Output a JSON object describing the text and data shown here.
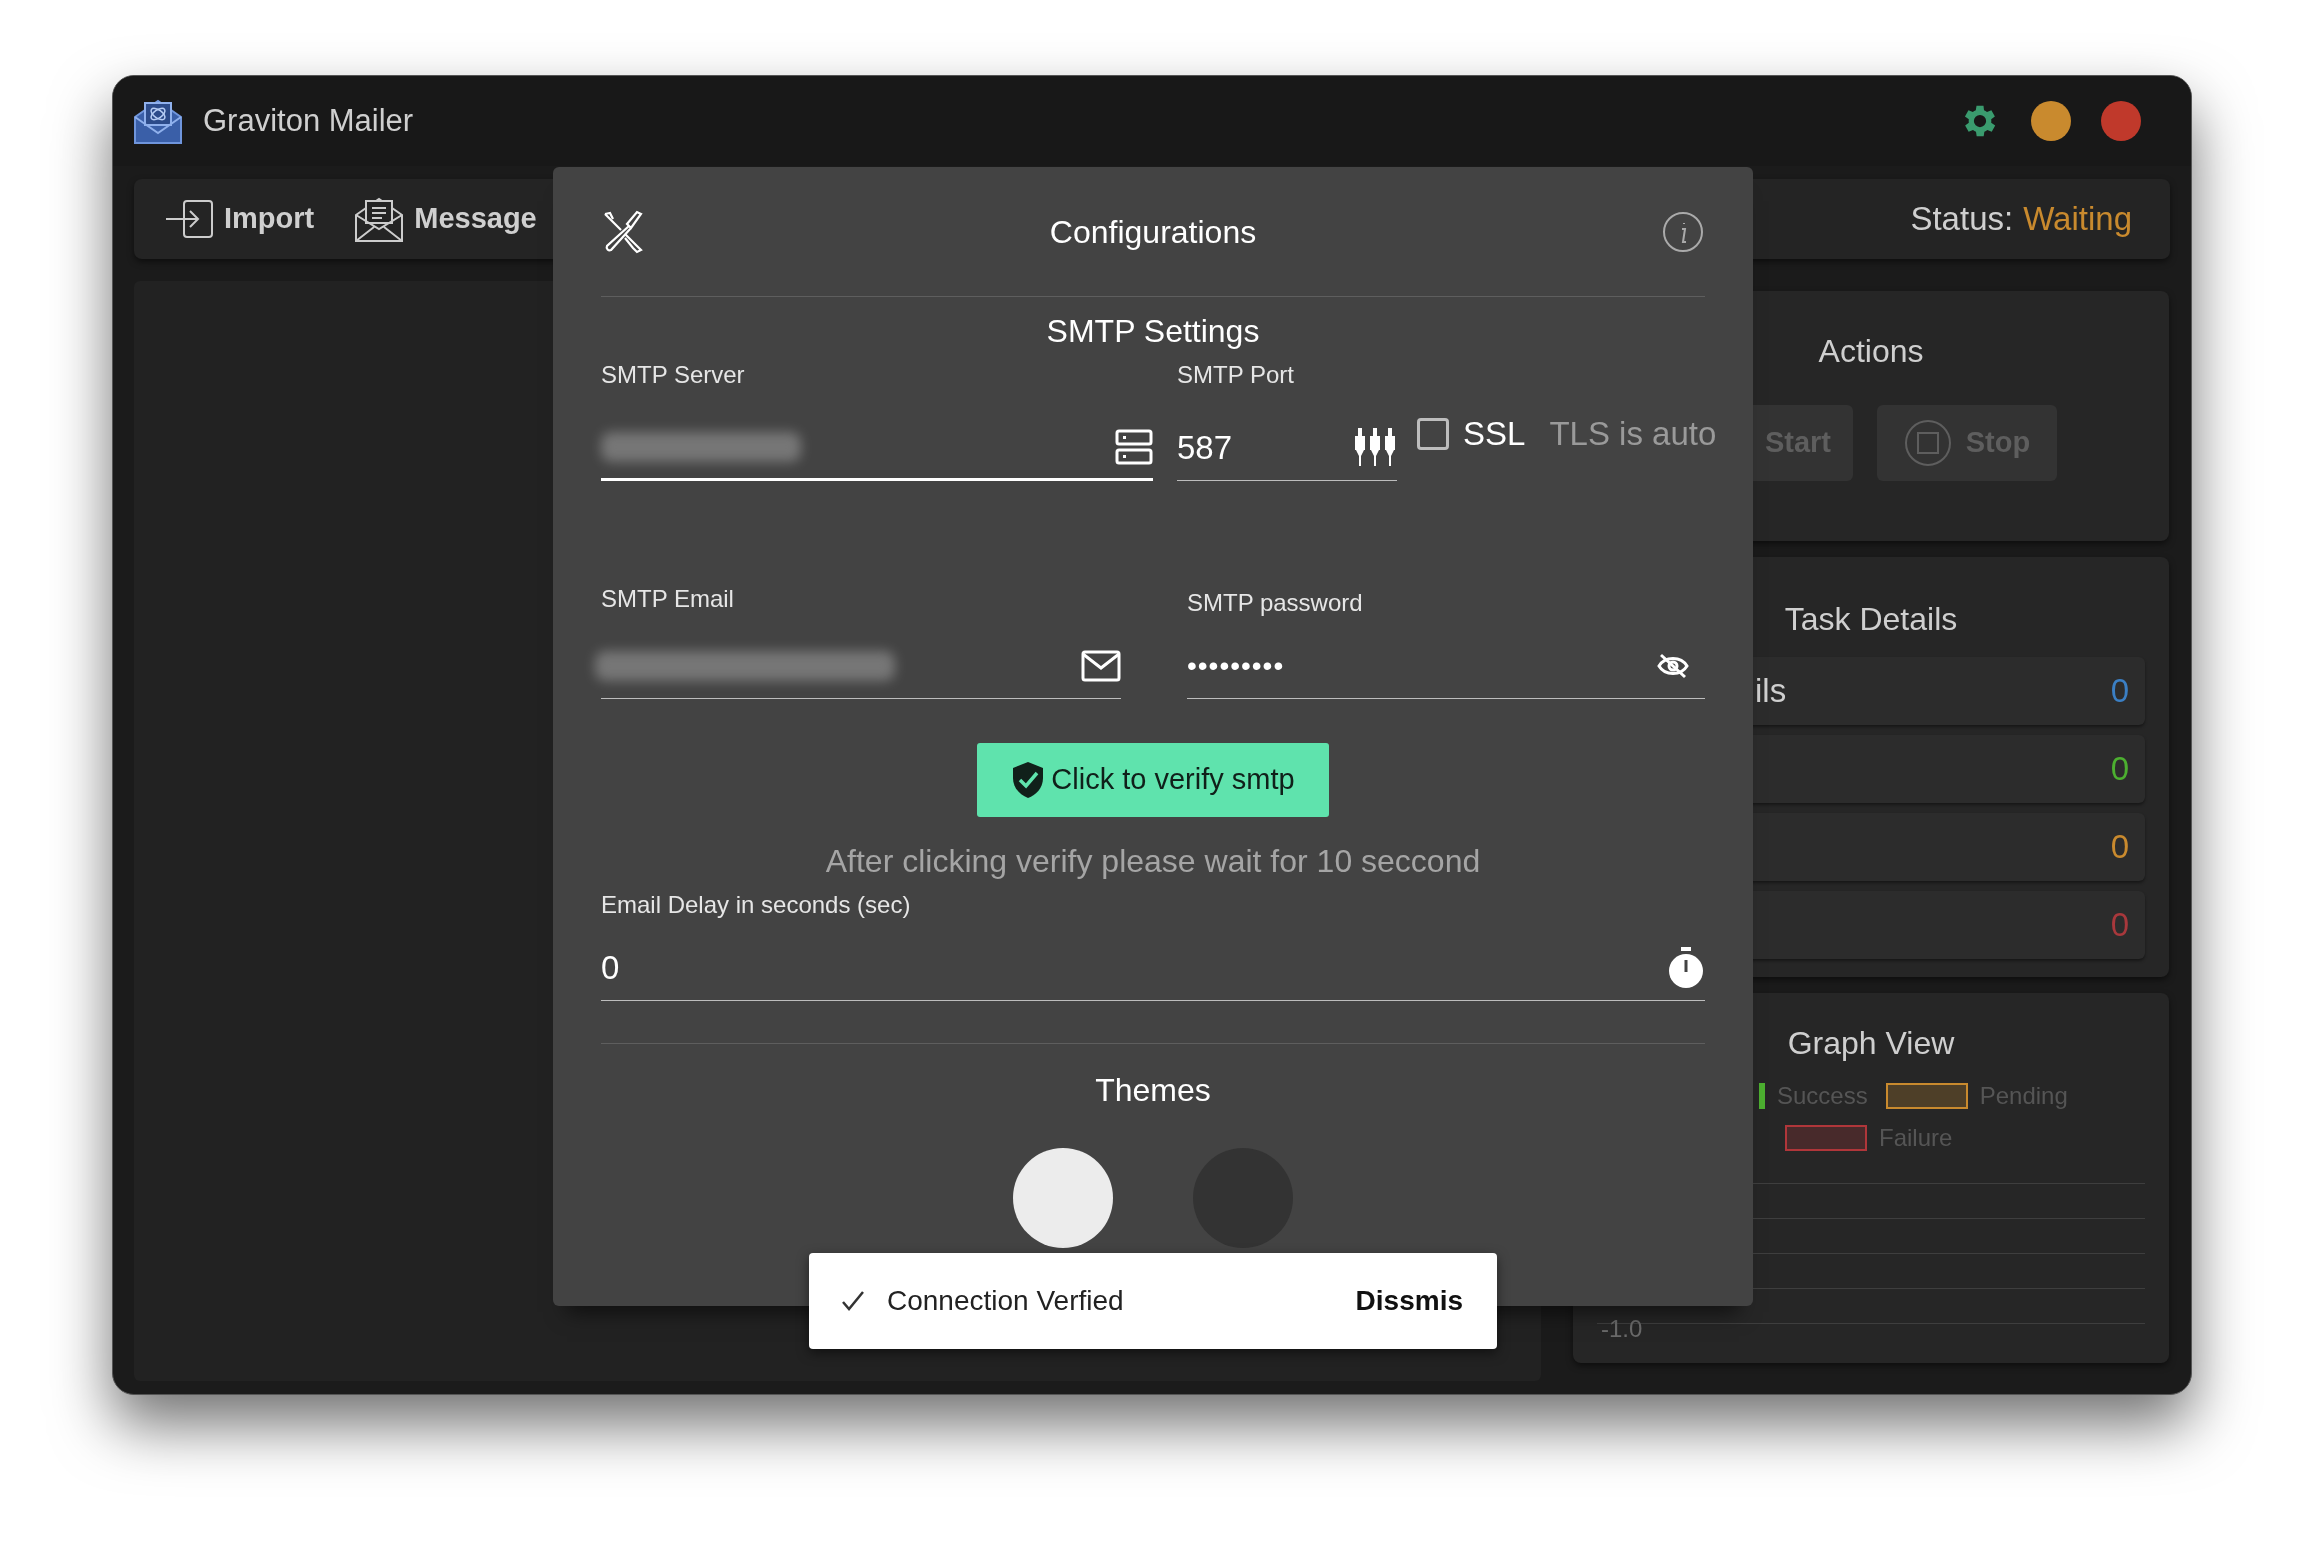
{
  "app": {
    "title": "Graviton Mailer"
  },
  "toolbar": {
    "items": [
      {
        "label": "Import",
        "kind": "import"
      },
      {
        "label": "Message",
        "kind": "message"
      }
    ],
    "status_label": "Status:",
    "status_value": "Waiting"
  },
  "actions": {
    "title": "Actions",
    "buttons": [
      {
        "label": "Start",
        "disabled": true,
        "kind": "start"
      },
      {
        "label": "Stop",
        "disabled": true,
        "kind": "stop"
      }
    ]
  },
  "task_details": {
    "title": "Task Details",
    "rows": [
      {
        "label": "ils",
        "value": "0",
        "color": "#3b7fc4"
      },
      {
        "value": "0",
        "color": "#4caf30"
      },
      {
        "value": "0",
        "color": "#c98a2e"
      },
      {
        "value": "0",
        "color": "#a8383c"
      }
    ]
  },
  "graph": {
    "title": "Graph View",
    "legend": [
      {
        "label": "Success",
        "color": "#4caf30"
      },
      {
        "label": "Pending",
        "color": "#c98a2e"
      },
      {
        "label": "Failure",
        "color": "#b0363a"
      }
    ],
    "axis_label": "-1.0"
  },
  "dialog": {
    "title": "Configurations",
    "section": "SMTP Settings",
    "server": {
      "label": "SMTP Server",
      "blurred": true,
      "focused": true
    },
    "port": {
      "label": "SMTP Port",
      "value": "587",
      "focused": false
    },
    "ssl": {
      "label": "SSL",
      "checked": false
    },
    "tls_note": "TLS is auto",
    "email": {
      "label": "SMTP Email",
      "blurred": true,
      "focused": false
    },
    "password": {
      "label": "SMTP password",
      "value": "•••••••••",
      "focused": false
    },
    "verify_button": "Click to verify smtp",
    "note": "After clicking verify please wait for 10 seccond",
    "delay": {
      "label": "Email Delay in seconds (sec)",
      "value": "0",
      "focused": false
    },
    "themes": {
      "title": "Themes",
      "options": [
        {
          "color": "#ececec"
        },
        {
          "color": "#333333"
        }
      ]
    }
  },
  "snackbar": {
    "message": "Connection Verfied",
    "action": "Dissmis"
  }
}
